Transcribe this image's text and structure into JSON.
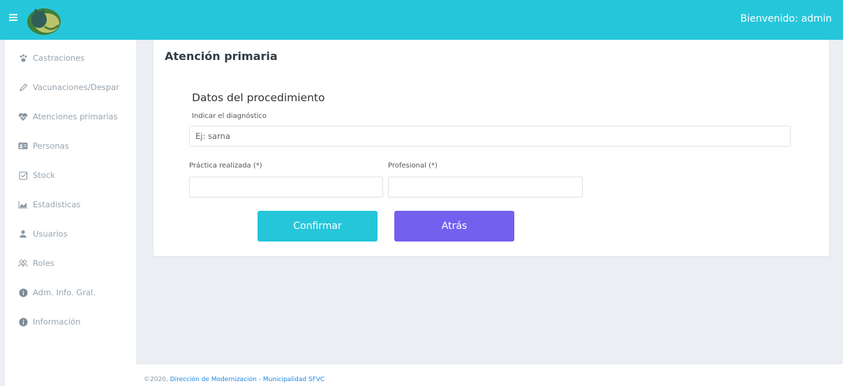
{
  "header": {
    "welcome": "Bienvenido: admin",
    "menu_icon": "hamburger-icon",
    "logo_icon": "cat-logo-icon"
  },
  "sidebar": {
    "items": [
      {
        "label": "Castraciones",
        "icon": "paw-icon"
      },
      {
        "label": "Vacunaciones/Despar",
        "icon": "pencil-icon"
      },
      {
        "label": "Atenciones primarias",
        "icon": "heartbeat-icon"
      },
      {
        "label": "Personas",
        "icon": "id-card-icon"
      },
      {
        "label": "Stock",
        "icon": "checkbox-icon"
      },
      {
        "label": "Estadisticas",
        "icon": "area-chart-icon"
      },
      {
        "label": "Usuarios",
        "icon": "user-icon"
      },
      {
        "label": "Roles",
        "icon": "users-icon"
      },
      {
        "label": "Adm. Info. Gral.",
        "icon": "info-circle-icon"
      },
      {
        "label": "Información",
        "icon": "info-circle-icon"
      }
    ]
  },
  "card": {
    "title": "Atención primaria",
    "section_title": "Datos del procedimiento",
    "diagnosis_label": "Indicar el diagnóstico",
    "diagnosis_placeholder": "Ej: sarna",
    "practice_label": "Práctica realizada (*)",
    "practice_value": "",
    "professional_label": "Profesional (*)",
    "professional_value": "",
    "confirm_label": "Confirmar",
    "back_label": "Atrás"
  },
  "footer": {
    "copyright": "©2020,",
    "link": "Dirección de Modernización - Municipalidad SFVC"
  },
  "colors": {
    "topbar": "#26c6da",
    "confirm": "#26c6da",
    "back": "#7460ee",
    "background": "#ebeef3"
  }
}
